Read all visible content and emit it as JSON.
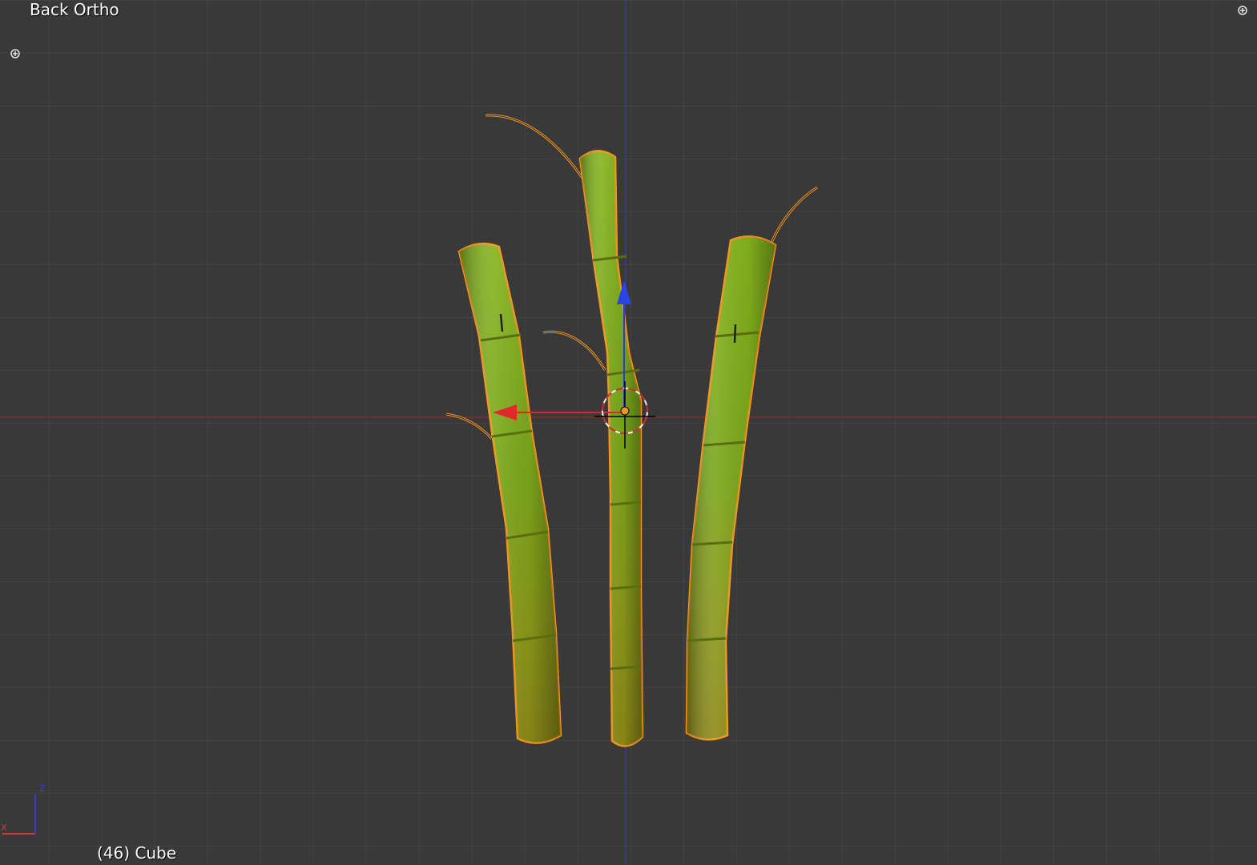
{
  "viewport": {
    "view_label": "Back Ortho",
    "object_info": "(46) Cube",
    "grid_color": "#4a4a4a",
    "background_color": "#393939"
  },
  "axes": {
    "x_axis_color": "#c83c3c",
    "z_axis_color": "#3c3cc8",
    "mini_axis_x_label": "X",
    "mini_axis_z_label": "Z"
  },
  "selection": {
    "outline_color": "#f0961e",
    "object_color": "#7aa820"
  },
  "icons": {
    "area_split_top_left": "plus-circle-icon",
    "area_split_top_right": "plus-circle-icon",
    "manipulator": "transform-manipulator-icon",
    "cursor_3d": "3d-cursor-icon"
  }
}
